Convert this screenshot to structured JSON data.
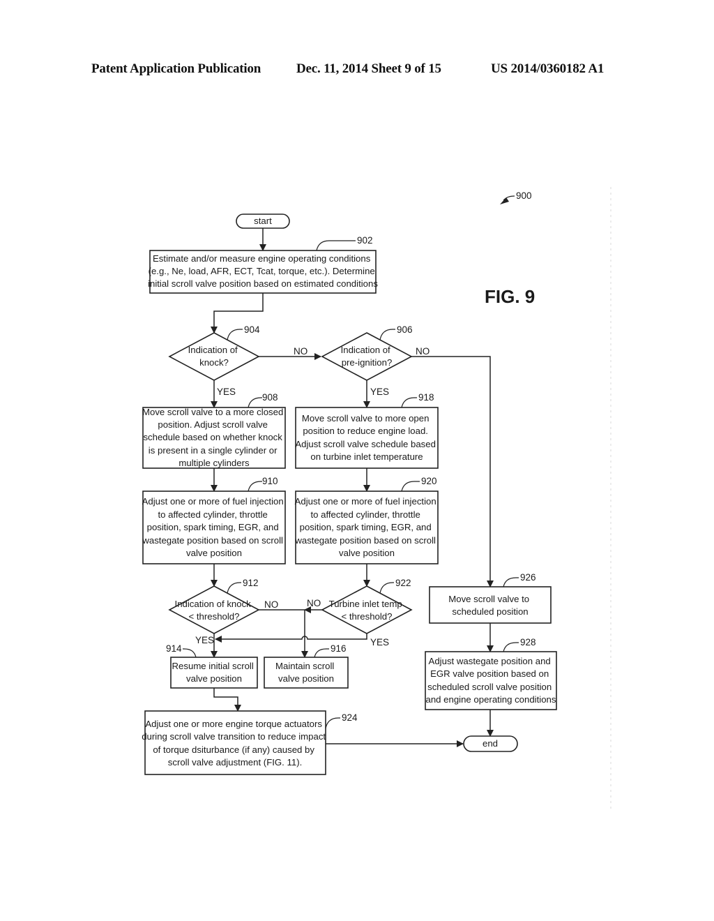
{
  "header": {
    "publication": "Patent Application Publication",
    "date_sheet": "Dec. 11, 2014   Sheet 9 of 15",
    "number": "US 2014/0360182 A1"
  },
  "figure": {
    "label": "FIG. 9",
    "ref": "900"
  },
  "nodes": {
    "start": {
      "label": "start"
    },
    "n902": {
      "ref": "902",
      "lines": [
        "Estimate and/or measure engine operating conditions",
        "(e.g., Ne, load, AFR, ECT, Tcat, torque, etc.). Determine",
        "initial scroll valve position based on estimated conditions"
      ]
    },
    "n904": {
      "ref": "904",
      "lines": [
        "Indication of",
        "knock?"
      ]
    },
    "n906": {
      "ref": "906",
      "lines": [
        "Indication of",
        "pre-ignition?"
      ]
    },
    "n908": {
      "ref": "908",
      "lines": [
        "Move scroll valve to a more closed",
        "position.  Adjust scroll valve",
        "schedule based on whether knock",
        "is present in a single cylinder or",
        "multiple cylinders"
      ]
    },
    "n918": {
      "ref": "918",
      "lines": [
        "Move scroll valve to more open",
        "position to reduce engine load.",
        "Adjust scroll valve schedule based",
        "on turbine inlet temperature"
      ]
    },
    "n910": {
      "ref": "910",
      "lines": [
        "Adjust one or more of fuel injection",
        "to affected cylinder, throttle",
        "position, spark timing, EGR, and",
        "wastegate position based on scroll",
        "valve position"
      ]
    },
    "n920": {
      "ref": "920",
      "lines": [
        "Adjust one or more of fuel injection",
        "to affected cylinder, throttle",
        "position, spark timing, EGR, and",
        "wastegate position based on scroll",
        "valve position"
      ]
    },
    "n912": {
      "ref": "912",
      "lines": [
        "Indication of knock",
        "< threshold?"
      ]
    },
    "n922": {
      "ref": "922",
      "lines": [
        "Turbine inlet temp",
        "< threshold?"
      ]
    },
    "n914": {
      "ref": "914",
      "lines": [
        "Resume initial scroll",
        "valve position"
      ]
    },
    "n916": {
      "ref": "916",
      "lines": [
        "Maintain scroll",
        "valve position"
      ]
    },
    "n926": {
      "ref": "926",
      "lines": [
        "Move scroll valve to",
        "scheduled position"
      ]
    },
    "n928": {
      "ref": "928",
      "lines": [
        "Adjust wastegate position and",
        "EGR valve position based on",
        "scheduled scroll valve position",
        "and engine operating conditions"
      ]
    },
    "n924": {
      "ref": "924",
      "lines": [
        "Adjust one or more engine torque actuators",
        "during scroll valve transition to reduce impact",
        "of torque dsiturbance (if any) caused by",
        "scroll valve adjustment (FIG. 11)."
      ]
    },
    "end": {
      "label": "end"
    }
  },
  "branch_labels": {
    "yes": "YES",
    "no": "NO"
  }
}
